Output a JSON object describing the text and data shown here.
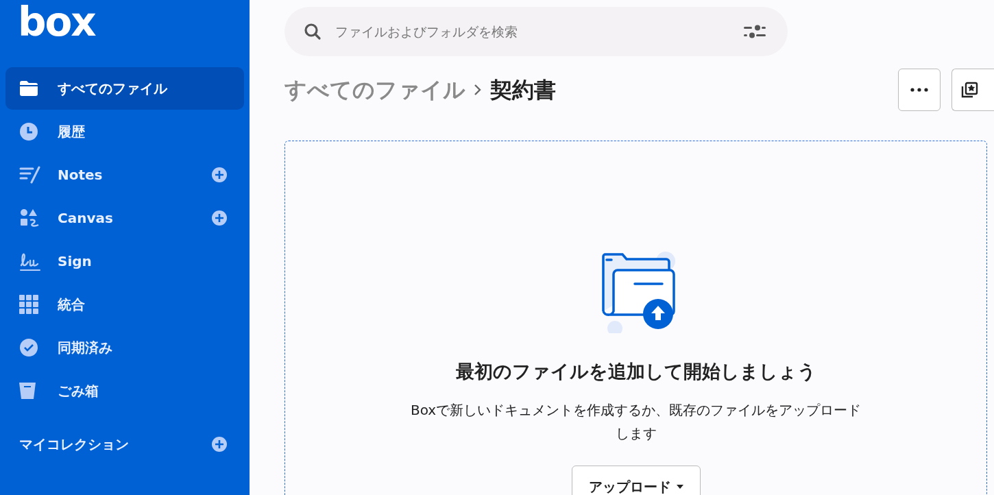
{
  "logo": {
    "text": "box"
  },
  "sidebar": {
    "items": [
      {
        "label": "すべてのファイル",
        "kind": "folder",
        "selected": true,
        "add_button": false
      },
      {
        "label": "履歴",
        "kind": "recent",
        "selected": false,
        "add_button": false
      },
      {
        "label": "Notes",
        "kind": "notes",
        "selected": false,
        "add_button": true
      },
      {
        "label": "Canvas",
        "kind": "canvas",
        "selected": false,
        "add_button": true
      },
      {
        "label": "Sign",
        "kind": "sign",
        "selected": false,
        "add_button": false
      },
      {
        "label": "統合",
        "kind": "integrations",
        "selected": false,
        "add_button": false
      },
      {
        "label": "同期済み",
        "kind": "synced",
        "selected": false,
        "add_button": false
      },
      {
        "label": "ごみ箱",
        "kind": "trash",
        "selected": false,
        "add_button": false
      }
    ],
    "section": {
      "title": "マイコレクション",
      "add_button": true
    }
  },
  "search": {
    "placeholder": "ファイルおよびフォルダを検索"
  },
  "breadcrumb": [
    {
      "label": "すべてのファイル",
      "current": false
    },
    {
      "label": "契約書",
      "current": true
    }
  ],
  "empty_state": {
    "title": "最初のファイルを追加して開始しましょう",
    "description": "Boxで新しいドキュメントを作成するか、既存のファイルをアップロードします",
    "button": "アップロード"
  }
}
